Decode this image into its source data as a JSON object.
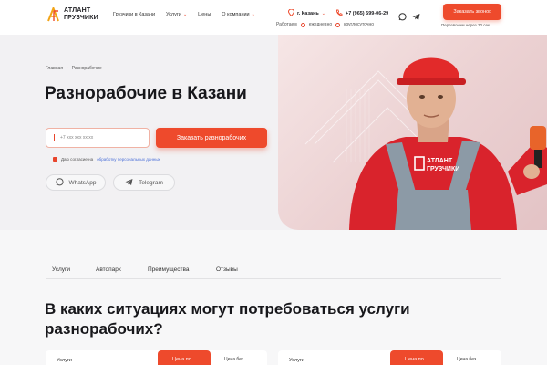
{
  "brand": {
    "line1": "АТЛАНТ",
    "line2": "ГРУЗЧИКИ"
  },
  "nav": [
    {
      "label": "Грузчики в Казани",
      "dropdown": false
    },
    {
      "label": "Услуги",
      "dropdown": true
    },
    {
      "label": "Цены",
      "dropdown": false
    },
    {
      "label": "О компании",
      "dropdown": true
    }
  ],
  "header": {
    "city": "г. Казань",
    "phone": "+7 (965) 599-06-29",
    "hours_prefix": "Работаем",
    "hours_days": "ежедневно",
    "hours_time": "круглосуточно",
    "call_button": "Заказать звонок",
    "callback_note": "Перезвоним через 30 сек."
  },
  "hero": {
    "breadcrumb": {
      "home": "Главная",
      "current": "Разнорабочие"
    },
    "title": "Разнорабочие в Казани",
    "phone_placeholder": "+7 xxx xxx xx xx",
    "submit": "Заказать разнорабочих",
    "consent_text": "Даю согласие на",
    "consent_link": "обработку персональных данных",
    "whatsapp": "WhatsApp",
    "telegram": "Telegram"
  },
  "tabs": [
    "Услуги",
    "Автопарк",
    "Преимущества",
    "Отзывы"
  ],
  "section_title": "В каких ситуациях могут потребоваться услуги разнорабочих?",
  "cards": [
    {
      "col1": "Услуги",
      "col2": "Цена по",
      "col3": "Цена без"
    },
    {
      "col1": "Услуги",
      "col2": "Цена по",
      "col3": "Цена без"
    }
  ],
  "colors": {
    "accent": "#ee4a2c",
    "link": "#4a6fd8",
    "background": "#f7f7f8"
  }
}
